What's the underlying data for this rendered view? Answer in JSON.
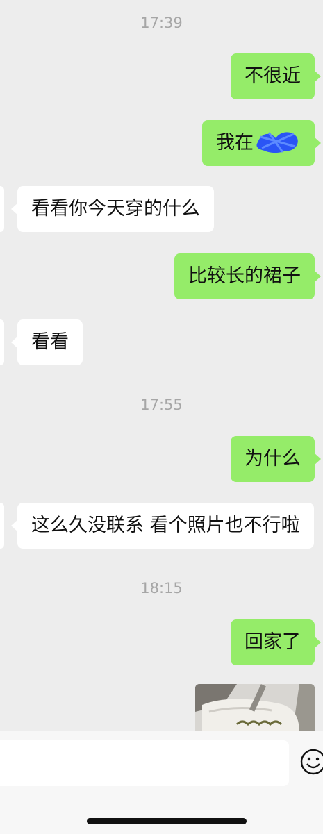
{
  "chat": {
    "timestamps": [
      "17:39",
      "17:55",
      "18:15"
    ],
    "messages": [
      {
        "side": "out",
        "text": "不很近"
      },
      {
        "side": "out",
        "text": "我在",
        "redacted": true
      },
      {
        "side": "in",
        "text": "看看你今天穿的什么"
      },
      {
        "side": "out",
        "text": "比较长的裙子"
      },
      {
        "side": "in",
        "text": "看看"
      },
      {
        "side": "out",
        "text": "为什么"
      },
      {
        "side": "in",
        "text": "这么久没联系 看个照片也不行啦"
      },
      {
        "side": "out",
        "text": "回家了"
      },
      {
        "side": "out",
        "type": "image",
        "icon": "photo-thumbnail"
      }
    ]
  },
  "input_bar": {
    "emoji_icon": "smiley-icon",
    "colors": {
      "outgoing": "#95ec69",
      "incoming": "#ffffff",
      "background": "#ededed"
    }
  }
}
